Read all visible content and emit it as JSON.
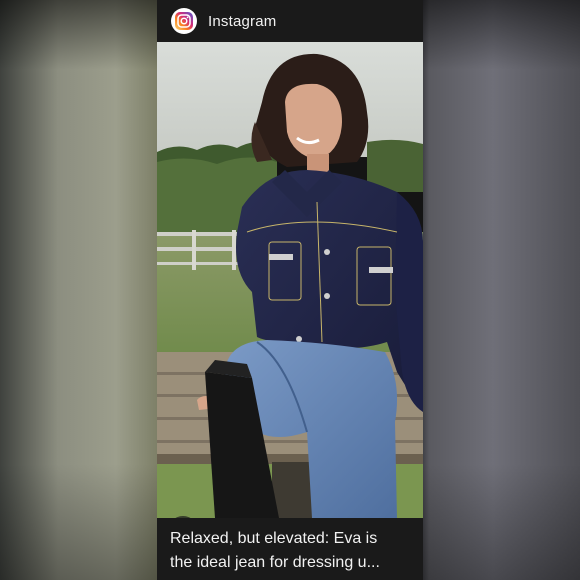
{
  "header": {
    "app_name": "Instagram",
    "logo_icon": "instagram-logo-icon"
  },
  "photo": {
    "description_icon": "photo-of-woman-in-denim-jacket"
  },
  "lens_button": {
    "icon": "google-lens-icon"
  },
  "caption": {
    "title_line1": "Relaxed, but elevated: Eva is",
    "title_line2": "the ideal jean for dressing u..."
  },
  "colors": {
    "card_background": "#141414",
    "caption_text": "#f2f2f2",
    "instagram_gradient_start": "#feda75",
    "instagram_gradient_mid": "#d62976",
    "instagram_gradient_end": "#4f5bd5"
  }
}
